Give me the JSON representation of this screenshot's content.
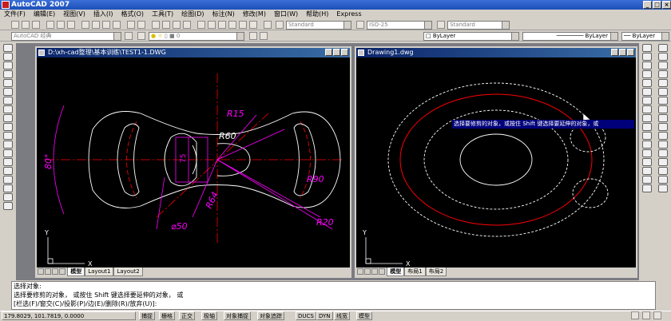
{
  "app": {
    "title": "AutoCAD 2007"
  },
  "menu": [
    "文件(F)",
    "编辑(E)",
    "视图(V)",
    "插入(I)",
    "格式(O)",
    "工具(T)",
    "绘图(D)",
    "标注(N)",
    "修改(M)",
    "窗口(W)",
    "帮助(H)",
    "Express"
  ],
  "toolbar": {
    "text_style": "Standard",
    "dim_style": "ISO-25",
    "table_style": "Standard",
    "workspace": "AutoCAD 经典",
    "layer": "0",
    "color": "ByLayer",
    "linetype": "ByLayer",
    "lineweight": "ByLayer"
  },
  "windows": {
    "left": {
      "title": "D:\\xh-cad整理\\基本训练\\TEST1-1.DWG",
      "tabs": [
        "模型",
        "Layout1",
        "Layout2"
      ],
      "dims": {
        "r15": "R15",
        "r60": "R60",
        "r90": "R90",
        "r20": "R20",
        "r64": "R64",
        "d50": "⌀50",
        "a80": "80°",
        "l75": "75"
      }
    },
    "right": {
      "title": "Drawing1.dwg",
      "tabs": [
        "模型",
        "布局1",
        "布局2"
      ]
    },
    "ucs": {
      "x": "X",
      "y": "Y"
    }
  },
  "tooltip": "选择要修剪的对象，或按住 Shift 键选择要延伸的对象，或",
  "command": {
    "line1": "选择对象:",
    "line2": "选择要修剪的对象， 或按住 Shift 键选择要延伸的对象， 或",
    "line3": "[栏选(F)/窗交(C)/投影(P)/边(E)/删除(R)/放弃(U)]:"
  },
  "status": {
    "coords": "179.8029, 101.7819, 0.0000",
    "buttons": [
      "捕捉",
      "栅格",
      "正交",
      "极轴",
      "对象捕捉",
      "对象追踪",
      "DUCS",
      "DYN",
      "线宽",
      "模型"
    ]
  },
  "colors": {
    "magenta": "#ff00ff",
    "red": "#ff0000",
    "white": "#ffffff",
    "title_blue": "#0a246a"
  }
}
